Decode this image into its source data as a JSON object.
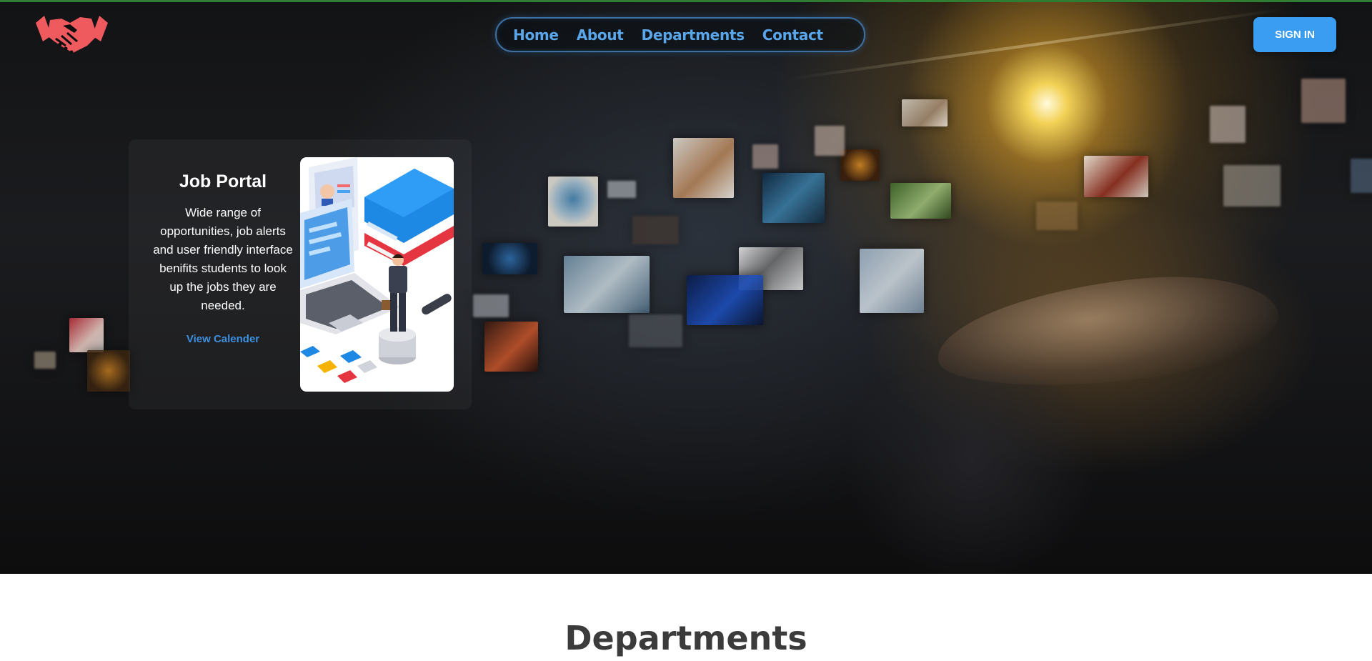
{
  "brand": {
    "logo_icon": "handshake-icon",
    "logo_color": "#ef5a5f"
  },
  "nav": {
    "items": [
      {
        "label": "Home"
      },
      {
        "label": "About"
      },
      {
        "label": "Departments"
      },
      {
        "label": "Contact"
      }
    ],
    "link_color": "#5aa6ea"
  },
  "signin": {
    "label": "SIGN IN",
    "color": "#3b9df2"
  },
  "hero_card": {
    "title": "Job Portal",
    "description": "Wide range of opportunities, job alerts and user friendly interface benifits students to look up the jobs they are needed.",
    "link_label": "View Calender",
    "illustration": "job-portal-illustration"
  },
  "sections": {
    "departments_title": "Departments"
  },
  "colors": {
    "top_line": "#2e7d32",
    "accent": "#3b9df2"
  }
}
